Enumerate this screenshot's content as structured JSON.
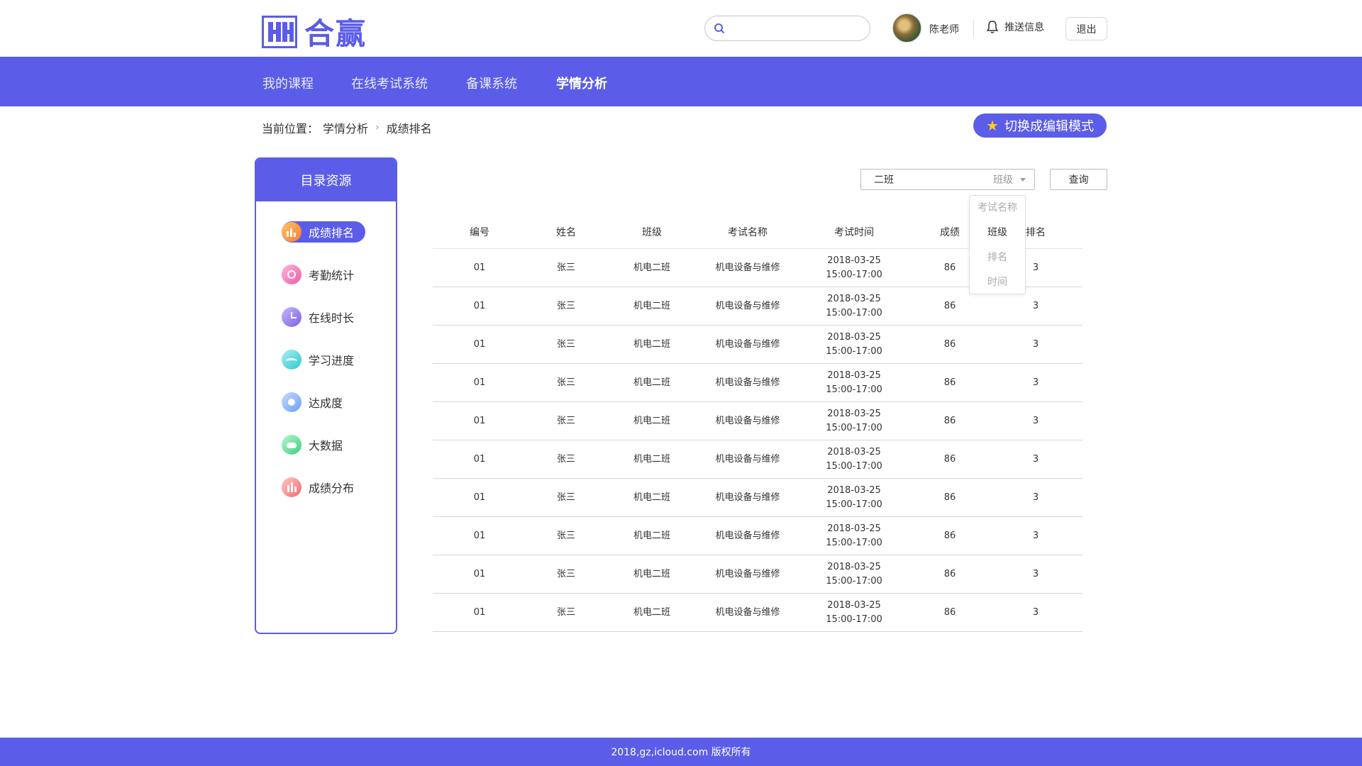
{
  "header": {
    "logo_text": "合赢",
    "search_placeholder": "",
    "username": "陈老师",
    "push_label": "推送信息",
    "logout_label": "退出"
  },
  "nav": {
    "items": [
      "我的课程",
      "在线考试系统",
      "备课系统",
      "学情分析"
    ],
    "active": "学情分析"
  },
  "breadcrumb": {
    "prefix": "当前位置：",
    "level1": "学情分析",
    "level2": "成绩排名"
  },
  "switch_button": {
    "label": "切换成编辑模式"
  },
  "sidebar": {
    "title": "目录资源",
    "items": [
      {
        "label": "成绩排名",
        "active": true
      },
      {
        "label": "考勤统计"
      },
      {
        "label": "在线时长"
      },
      {
        "label": "学习进度"
      },
      {
        "label": "达成度"
      },
      {
        "label": "大数据"
      },
      {
        "label": "成绩分布"
      }
    ]
  },
  "filter": {
    "value": "二班",
    "kind": "班级",
    "query_label": "查询",
    "options": [
      "考试名称",
      "班级",
      "排名",
      "时间"
    ],
    "selected_option": "班级"
  },
  "table": {
    "headers": [
      "编号",
      "姓名",
      "班级",
      "考试名称",
      "考试时间",
      "成绩",
      "排名"
    ],
    "rows": [
      {
        "id": "01",
        "name": "张三",
        "class": "机电二班",
        "exam": "机电设备与维修",
        "date": "2018-03-25",
        "time": "15:00-17:00",
        "score": "86",
        "rank": "3"
      },
      {
        "id": "01",
        "name": "张三",
        "class": "机电二班",
        "exam": "机电设备与维修",
        "date": "2018-03-25",
        "time": "15:00-17:00",
        "score": "86",
        "rank": "3"
      },
      {
        "id": "01",
        "name": "张三",
        "class": "机电二班",
        "exam": "机电设备与维修",
        "date": "2018-03-25",
        "time": "15:00-17:00",
        "score": "86",
        "rank": "3"
      },
      {
        "id": "01",
        "name": "张三",
        "class": "机电二班",
        "exam": "机电设备与维修",
        "date": "2018-03-25",
        "time": "15:00-17:00",
        "score": "86",
        "rank": "3"
      },
      {
        "id": "01",
        "name": "张三",
        "class": "机电二班",
        "exam": "机电设备与维修",
        "date": "2018-03-25",
        "time": "15:00-17:00",
        "score": "86",
        "rank": "3"
      },
      {
        "id": "01",
        "name": "张三",
        "class": "机电二班",
        "exam": "机电设备与维修",
        "date": "2018-03-25",
        "time": "15:00-17:00",
        "score": "86",
        "rank": "3"
      },
      {
        "id": "01",
        "name": "张三",
        "class": "机电二班",
        "exam": "机电设备与维修",
        "date": "2018-03-25",
        "time": "15:00-17:00",
        "score": "86",
        "rank": "3"
      },
      {
        "id": "01",
        "name": "张三",
        "class": "机电二班",
        "exam": "机电设备与维修",
        "date": "2018-03-25",
        "time": "15:00-17:00",
        "score": "86",
        "rank": "3"
      },
      {
        "id": "01",
        "name": "张三",
        "class": "机电二班",
        "exam": "机电设备与维修",
        "date": "2018-03-25",
        "time": "15:00-17:00",
        "score": "86",
        "rank": "3"
      },
      {
        "id": "01",
        "name": "张三",
        "class": "机电二班",
        "exam": "机电设备与维修",
        "date": "2018-03-25",
        "time": "15:00-17:00",
        "score": "86",
        "rank": "3"
      }
    ]
  },
  "footer": {
    "text": "2018,gz,icloud.com 版权所有"
  },
  "colors": {
    "primary": "#5b5de8",
    "star": "#ffcc1f"
  }
}
